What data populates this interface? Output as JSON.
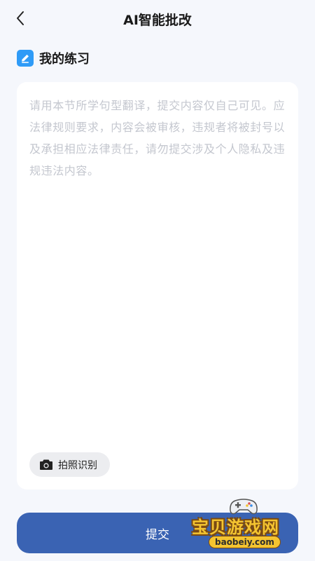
{
  "nav": {
    "title": "AI智能批改",
    "back_icon": "chevron-left-icon"
  },
  "section": {
    "title": "我的练习",
    "icon": "pencil-icon",
    "icon_color": "#2f9bf7"
  },
  "practice": {
    "value": "",
    "placeholder": "请用本节所学句型翻译，提交内容仅自己可见。应法律规则要求，内容会被审核，违规者将被封号以及承担相应法律责任，请勿提交涉及个人隐私及违规违法内容。"
  },
  "ocr_button": {
    "label": "拍照识别",
    "icon": "camera-icon"
  },
  "submit": {
    "label": "提交",
    "color": "#3a63b3"
  },
  "watermark": {
    "text": "宝贝游戏网",
    "url": "baobeiy.com"
  }
}
